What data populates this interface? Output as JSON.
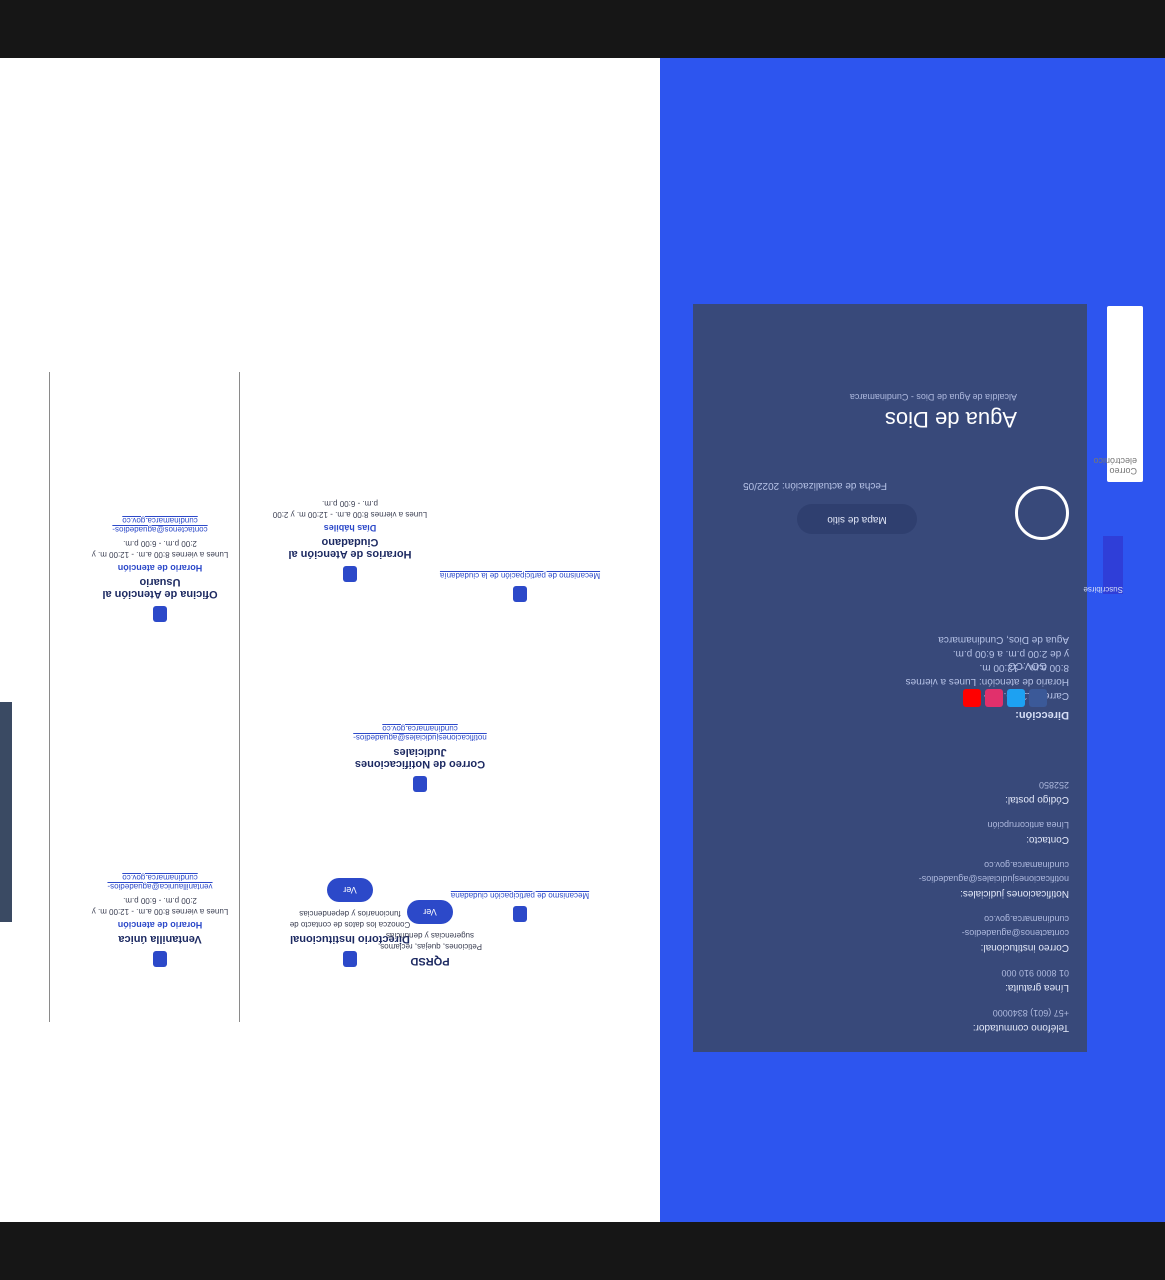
{
  "content": {
    "cards": [
      {
        "title": "Ventanilla única",
        "sub": "Horario de atención",
        "txt": "Lunes a viernes 8:00 a.m. - 12:00 m. y 2:00 p.m. - 6:00 p.m.",
        "link": "ventanillaunica@aguadedios-cundinamarca.gov.co"
      },
      {
        "title": "Oficina de Atención al Usuario",
        "sub": "Horario de atención",
        "txt": "Lunes a viernes 8:00 a.m. - 12:00 m. y 2:00 p.m. - 6:00 p.m.",
        "link": "contactenos@aguadedios-cundinamarca.gov.co"
      },
      {
        "title": "Directorio Institucional",
        "sub": "",
        "txt": "Conozca los datos de contacto de funcionarios y dependencias",
        "link": "Ver"
      },
      {
        "title": "Horarios de Atención al Ciudadano",
        "sub": "Días hábiles",
        "txt": "Lunes a viernes 8:00 a.m. - 12:00 m. y 2:00 p.m. - 6:00 p.m.",
        "link": ""
      },
      {
        "title": "Correo de Notificaciones Judiciales",
        "sub": "",
        "txt": "notificacionesjudiciales@aguadedios-cundinamarca.gov.co",
        "link": ""
      },
      {
        "title": "PQRSD",
        "sub": "",
        "txt": "Peticiones, quejas, reclamos, sugerencias y denuncias",
        "link": "Ver"
      }
    ],
    "bottom_links": [
      "Mecanismo de participación ciudadana",
      "Mecanismo de participación de la ciudadanía"
    ]
  },
  "footer": {
    "brand": "Agua de Dios",
    "tagline": "Alcaldía de Agua de Dios - Cundinamarca",
    "col1": [
      {
        "label": "Teléfono conmutador:",
        "value": "+57 (601) 8340000"
      },
      {
        "label": "Línea gratuita:",
        "value": "01 8000 910 000"
      },
      {
        "label": "Correo institucional:",
        "value": "contactenos@aguadedios-cundinamarca.gov.co"
      },
      {
        "label": "Notificaciones judiciales:",
        "value": "notificacionesjudiciales@aguadedios-cundinamarca.gov.co"
      },
      {
        "label": "Contacto:",
        "value": "Línea anticorrupción"
      },
      {
        "label": "Código postal:",
        "value": "252850"
      }
    ],
    "col2_title": "Dirección:",
    "col2": [
      "Carrera 11 No. 12 - 33",
      "Horario de atención: Lunes a viernes 8:00 a.m. - 12:00 m.",
      "y de 2:00 p.m. a 6:00 p.m.",
      "Agua de Dios, Cundinamarca"
    ],
    "map_button": "Mapa de sitio",
    "govco": "GOV.CO",
    "last_update": "Fecha de actualización: 2022/05",
    "search_placeholder": "Correo electrónico",
    "search_button": "Suscribirse"
  }
}
